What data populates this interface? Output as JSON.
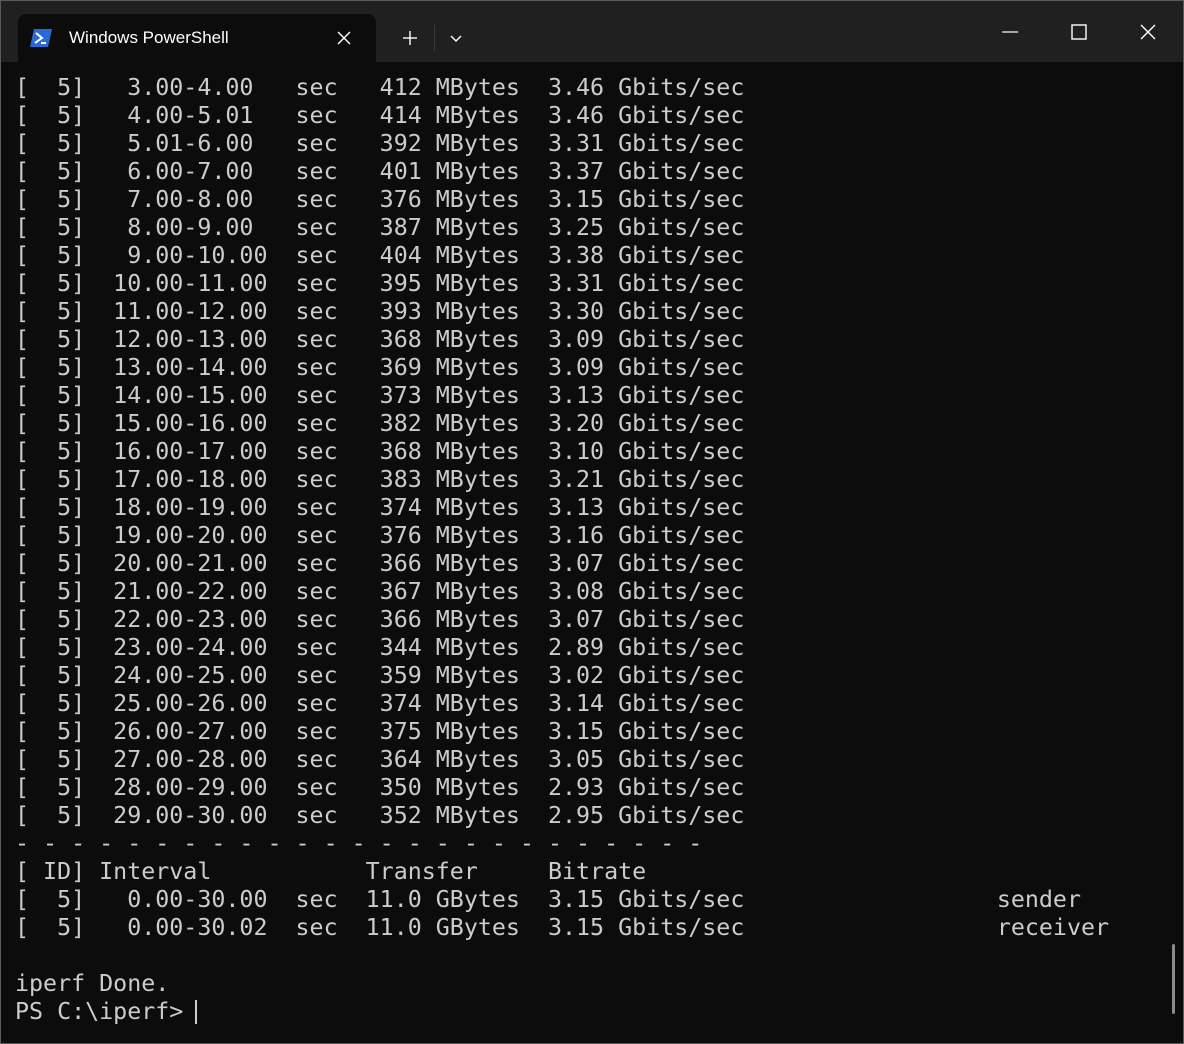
{
  "window": {
    "tab_title": "Windows PowerShell",
    "icons": {
      "tab": "powershell-icon",
      "tab_close": "close-icon",
      "new_tab": "plus-icon",
      "dropdown": "chevron-down-icon",
      "minimize": "minimize-icon",
      "maximize": "maximize-icon",
      "close": "close-icon"
    },
    "colors": {
      "titlebar": "#202020",
      "terminal_bg": "#0c0c0c",
      "text": "#cccccc",
      "powershell_blue": "#2b6ad6"
    }
  },
  "terminal": {
    "lines": [
      "[  5]   3.00-4.00   sec   412 MBytes  3.46 Gbits/sec",
      "[  5]   4.00-5.01   sec   414 MBytes  3.46 Gbits/sec",
      "[  5]   5.01-6.00   sec   392 MBytes  3.31 Gbits/sec",
      "[  5]   6.00-7.00   sec   401 MBytes  3.37 Gbits/sec",
      "[  5]   7.00-8.00   sec   376 MBytes  3.15 Gbits/sec",
      "[  5]   8.00-9.00   sec   387 MBytes  3.25 Gbits/sec",
      "[  5]   9.00-10.00  sec   404 MBytes  3.38 Gbits/sec",
      "[  5]  10.00-11.00  sec   395 MBytes  3.31 Gbits/sec",
      "[  5]  11.00-12.00  sec   393 MBytes  3.30 Gbits/sec",
      "[  5]  12.00-13.00  sec   368 MBytes  3.09 Gbits/sec",
      "[  5]  13.00-14.00  sec   369 MBytes  3.09 Gbits/sec",
      "[  5]  14.00-15.00  sec   373 MBytes  3.13 Gbits/sec",
      "[  5]  15.00-16.00  sec   382 MBytes  3.20 Gbits/sec",
      "[  5]  16.00-17.00  sec   368 MBytes  3.10 Gbits/sec",
      "[  5]  17.00-18.00  sec   383 MBytes  3.21 Gbits/sec",
      "[  5]  18.00-19.00  sec   374 MBytes  3.13 Gbits/sec",
      "[  5]  19.00-20.00  sec   376 MBytes  3.16 Gbits/sec",
      "[  5]  20.00-21.00  sec   366 MBytes  3.07 Gbits/sec",
      "[  5]  21.00-22.00  sec   367 MBytes  3.08 Gbits/sec",
      "[  5]  22.00-23.00  sec   366 MBytes  3.07 Gbits/sec",
      "[  5]  23.00-24.00  sec   344 MBytes  2.89 Gbits/sec",
      "[  5]  24.00-25.00  sec   359 MBytes  3.02 Gbits/sec",
      "[  5]  25.00-26.00  sec   374 MBytes  3.14 Gbits/sec",
      "[  5]  26.00-27.00  sec   375 MBytes  3.15 Gbits/sec",
      "[  5]  27.00-28.00  sec   364 MBytes  3.05 Gbits/sec",
      "[  5]  28.00-29.00  sec   350 MBytes  2.93 Gbits/sec",
      "[  5]  29.00-30.00  sec   352 MBytes  2.95 Gbits/sec",
      "- - - - - - - - - - - - - - - - - - - - - - - - -",
      "[ ID] Interval           Transfer     Bitrate",
      "[  5]   0.00-30.00  sec  11.0 GBytes  3.15 Gbits/sec                  sender",
      "[  5]   0.00-30.02  sec  11.0 GBytes  3.15 Gbits/sec                  receiver",
      "",
      "iperf Done."
    ],
    "prompt": "PS C:\\iperf>"
  }
}
